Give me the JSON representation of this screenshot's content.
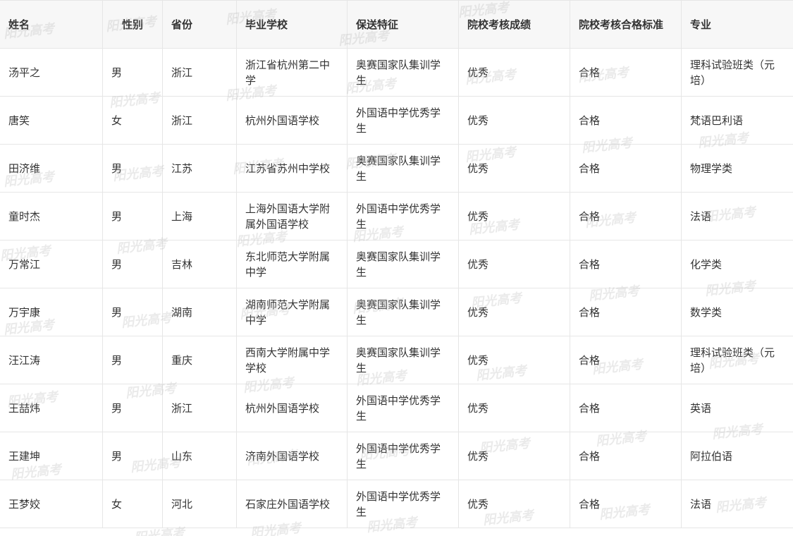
{
  "table": {
    "headers": [
      "姓名",
      "性别",
      "省份",
      "毕业学校",
      "保送特征",
      "院校考核成绩",
      "院校考核合格标准",
      "专业"
    ],
    "rows": [
      [
        "汤平之",
        "男",
        "浙江",
        "浙江省杭州第二中学",
        "奥赛国家队集训学生",
        "优秀",
        "合格",
        "理科试验班类（元培）"
      ],
      [
        "唐笑",
        "女",
        "浙江",
        "杭州外国语学校",
        "外国语中学优秀学生",
        "优秀",
        "合格",
        "梵语巴利语"
      ],
      [
        "田济维",
        "男",
        "江苏",
        "江苏省苏州中学校",
        "奥赛国家队集训学生",
        "优秀",
        "合格",
        "物理学类"
      ],
      [
        "童时杰",
        "男",
        "上海",
        "上海外国语大学附属外国语学校",
        "外国语中学优秀学生",
        "优秀",
        "合格",
        "法语"
      ],
      [
        "万常江",
        "男",
        "吉林",
        "东北师范大学附属中学",
        "奥赛国家队集训学生",
        "优秀",
        "合格",
        "化学类"
      ],
      [
        "万宇康",
        "男",
        "湖南",
        "湖南师范大学附属中学",
        "奥赛国家队集训学生",
        "优秀",
        "合格",
        "数学类"
      ],
      [
        "汪江涛",
        "男",
        "重庆",
        "西南大学附属中学学校",
        "奥赛国家队集训学生",
        "优秀",
        "合格",
        "理科试验班类（元培）"
      ],
      [
        "王喆炜",
        "男",
        "浙江",
        "杭州外国语学校",
        "外国语中学优秀学生",
        "优秀",
        "合格",
        "英语"
      ],
      [
        "王建坤",
        "男",
        "山东",
        "济南外国语学校",
        "外国语中学优秀学生",
        "优秀",
        "合格",
        "阿拉伯语"
      ],
      [
        "王梦姣",
        "女",
        "河北",
        "石家庄外国语学校",
        "外国语中学优秀学生",
        "优秀",
        "合格",
        "法语"
      ]
    ]
  },
  "watermark": {
    "text": "阳光高考"
  },
  "colors": {
    "header_bg": "#f7f7f7",
    "border": "#e6e6e6",
    "text": "#333333"
  }
}
